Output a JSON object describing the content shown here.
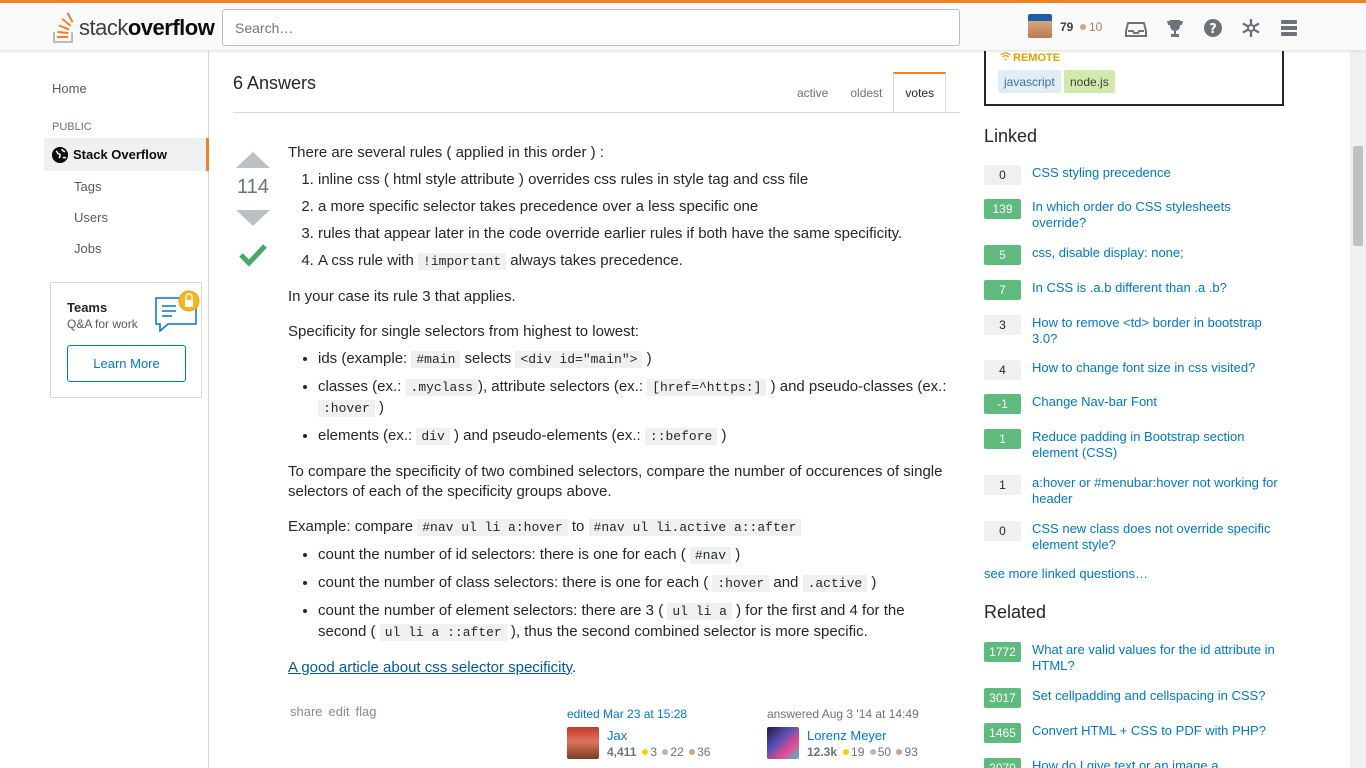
{
  "header": {
    "logo_prefix": "stack",
    "logo_bold": "overflow",
    "search_placeholder": "Search…",
    "reputation": "79",
    "bronze_badges": "10"
  },
  "leftnav": {
    "home": "Home",
    "public": "PUBLIC",
    "stack_overflow": "Stack Overflow",
    "tags": "Tags",
    "users": "Users",
    "jobs": "Jobs",
    "teams_title": "Teams",
    "teams_sub": "Q&A for work",
    "teams_button": "Learn More"
  },
  "answers": {
    "count_label": "6 Answers",
    "tabs": [
      "active",
      "oldest",
      "votes"
    ],
    "active_tab": "votes"
  },
  "answer": {
    "score": "114",
    "accepted": true,
    "intro": "There are several rules ( applied in this order ) :",
    "rules": [
      "inline css ( html style attribute ) overrides css rules in style tag and css file",
      "a more specific selector takes precedence over a less specific one",
      "rules that appear later in the code override earlier rules if both have the same specificity."
    ],
    "rule4_pre": "A css rule with ",
    "rule4_code": "!important",
    "rule4_post": " always takes precedence.",
    "p_case": "In your case its rule 3 that applies.",
    "p_spec": "Specificity for single selectors from highest to lowest:",
    "ids_pre": "ids (example: ",
    "ids_code1": "#main",
    "ids_mid": " selects ",
    "ids_code2": "<div id=\"main\">",
    "ids_post": " )",
    "cls_pre": "classes (ex.: ",
    "cls_code1": ".myclass",
    "cls_mid1": "), attribute selectors (ex.: ",
    "cls_code2": "[href=^https:]",
    "cls_mid2": " ) and pseudo-classes (ex.: ",
    "cls_code3": ":hover",
    "cls_post": " )",
    "el_pre": "elements (ex.: ",
    "el_code1": "div",
    "el_mid": " ) and pseudo-elements (ex.: ",
    "el_code2": "::before",
    "el_post": " )",
    "p_compare": "To compare the specificity of two combined selectors, compare the number of occurences of single selectors of each of the specificity groups above.",
    "ex_pre": "Example: compare ",
    "ex_code1": "#nav ul li a:hover",
    "ex_mid": " to ",
    "ex_code2": "#nav ul li.active a::after",
    "c1_pre": "count the number of id selectors: there is one for each ( ",
    "c1_code": "#nav",
    "c1_post": " )",
    "c2_pre": "count the number of class selectors: there is one for each ( ",
    "c2_code1": ":hover",
    "c2_mid": " and ",
    "c2_code2": ".active",
    "c2_post": " )",
    "c3_pre": "count the number of element selectors: there are 3 ( ",
    "c3_code1": "ul li a",
    "c3_mid": " ) for the first and 4 for the second ( ",
    "c3_code2": "ul li a ::after",
    "c3_post": " ), thus the second combined selector is more specific.",
    "article_link": "A good article about css selector specificity",
    "article_dot": ".",
    "menu": [
      "share",
      "edit",
      "flag"
    ],
    "edited": {
      "action": "edited Mar 23 at 15:28",
      "name": "Jax",
      "rep": "4,411",
      "gold": "3",
      "silver": "22",
      "bronze": "36"
    },
    "answered": {
      "action": "answered Aug 3 '14 at 14:49",
      "name": "Lorenz Meyer",
      "rep": "12.3k",
      "gold": "19",
      "silver": "50",
      "bronze": "93"
    }
  },
  "job": {
    "remote": "REMOTE",
    "tags": [
      "javascript",
      "node.js"
    ]
  },
  "linked": {
    "title": "Linked",
    "items": [
      {
        "score": "0",
        "title": "CSS styling precedence"
      },
      {
        "score": "139",
        "title": "In which order do CSS stylesheets override?"
      },
      {
        "score": "5",
        "title": "css, disable display: none;"
      },
      {
        "score": "7",
        "title": "In CSS is .a.b different than .a .b?"
      },
      {
        "score": "3",
        "title": "How to remove <td> border in bootstrap 3.0?"
      },
      {
        "score": "4",
        "title": "How to change font size in css visited?"
      },
      {
        "score": "-1",
        "title": "Change Nav-bar Font"
      },
      {
        "score": "1",
        "title": "Reduce padding in Bootstrap section element (CSS)"
      },
      {
        "score": "1",
        "title": "a:hover or #menubar:hover not working for header"
      },
      {
        "score": "0",
        "title": "CSS new class does not override specific element style?"
      }
    ],
    "see_more": "see more linked questions…"
  },
  "related": {
    "title": "Related",
    "items": [
      {
        "score": "1772",
        "title": "What are valid values for the id attribute in HTML?"
      },
      {
        "score": "3017",
        "title": "Set cellpadding and cellspacing in CSS?"
      },
      {
        "score": "1465",
        "title": "Convert HTML + CSS to PDF with PHP?"
      },
      {
        "score": "2070",
        "title": "How do I give text or an image a"
      }
    ]
  },
  "colors": {
    "accent": "#f48024",
    "link": "#0077cc",
    "accepted": "#48a868"
  }
}
